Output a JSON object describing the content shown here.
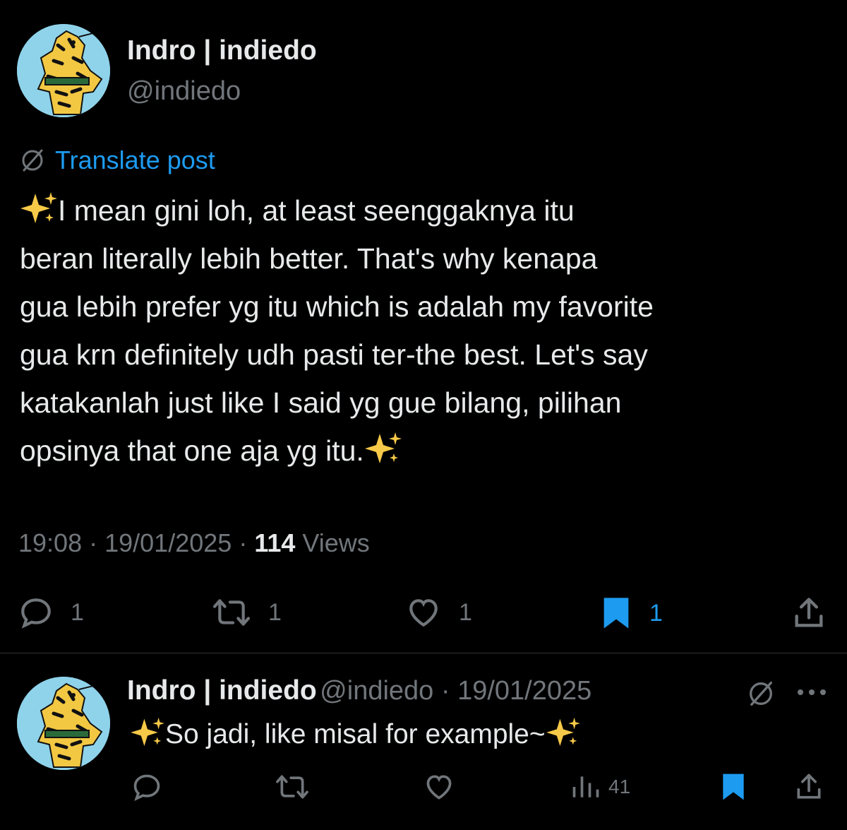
{
  "main_tweet": {
    "display_name": "Indro | indiedo",
    "handle": "@indiedo",
    "translate_label": "Translate post",
    "text": "I mean gini loh, at least seenggaknya itu\nberan literally lebih better. That's why kenapa\ngua lebih prefer yg itu which is adalah my favorite\ngua krn definitely udh pasti ter-the best. Let's say\nkatakanlah just like I said yg gue bilang, pilihan\nopsinya that one aja yg itu.",
    "time": "19:08",
    "date": "19/01/2025",
    "views_count": "114",
    "views_label": "Views",
    "replies": "1",
    "reposts": "1",
    "likes": "1",
    "bookmarks": "1"
  },
  "reply": {
    "display_name": "Indro | indiedo",
    "handle_date": "@indiedo · 19/01/2025",
    "text": "So jadi, like misal for example~",
    "views": "41"
  },
  "colors": {
    "background": "#000000",
    "text": "#e7e9ea",
    "muted": "#71767b",
    "accent": "#1d9bf0",
    "divider": "#2f3336"
  },
  "icons": {
    "avatar": "tiger-avatar",
    "translate": "globe-slash-icon",
    "sparkles": "sparkles-emoji",
    "reply": "speech-bubble-icon",
    "repost": "repost-icon",
    "like": "heart-icon",
    "bookmark": "bookmark-icon",
    "share": "share-icon",
    "views": "views-bars-icon",
    "more": "more-dots-icon"
  }
}
